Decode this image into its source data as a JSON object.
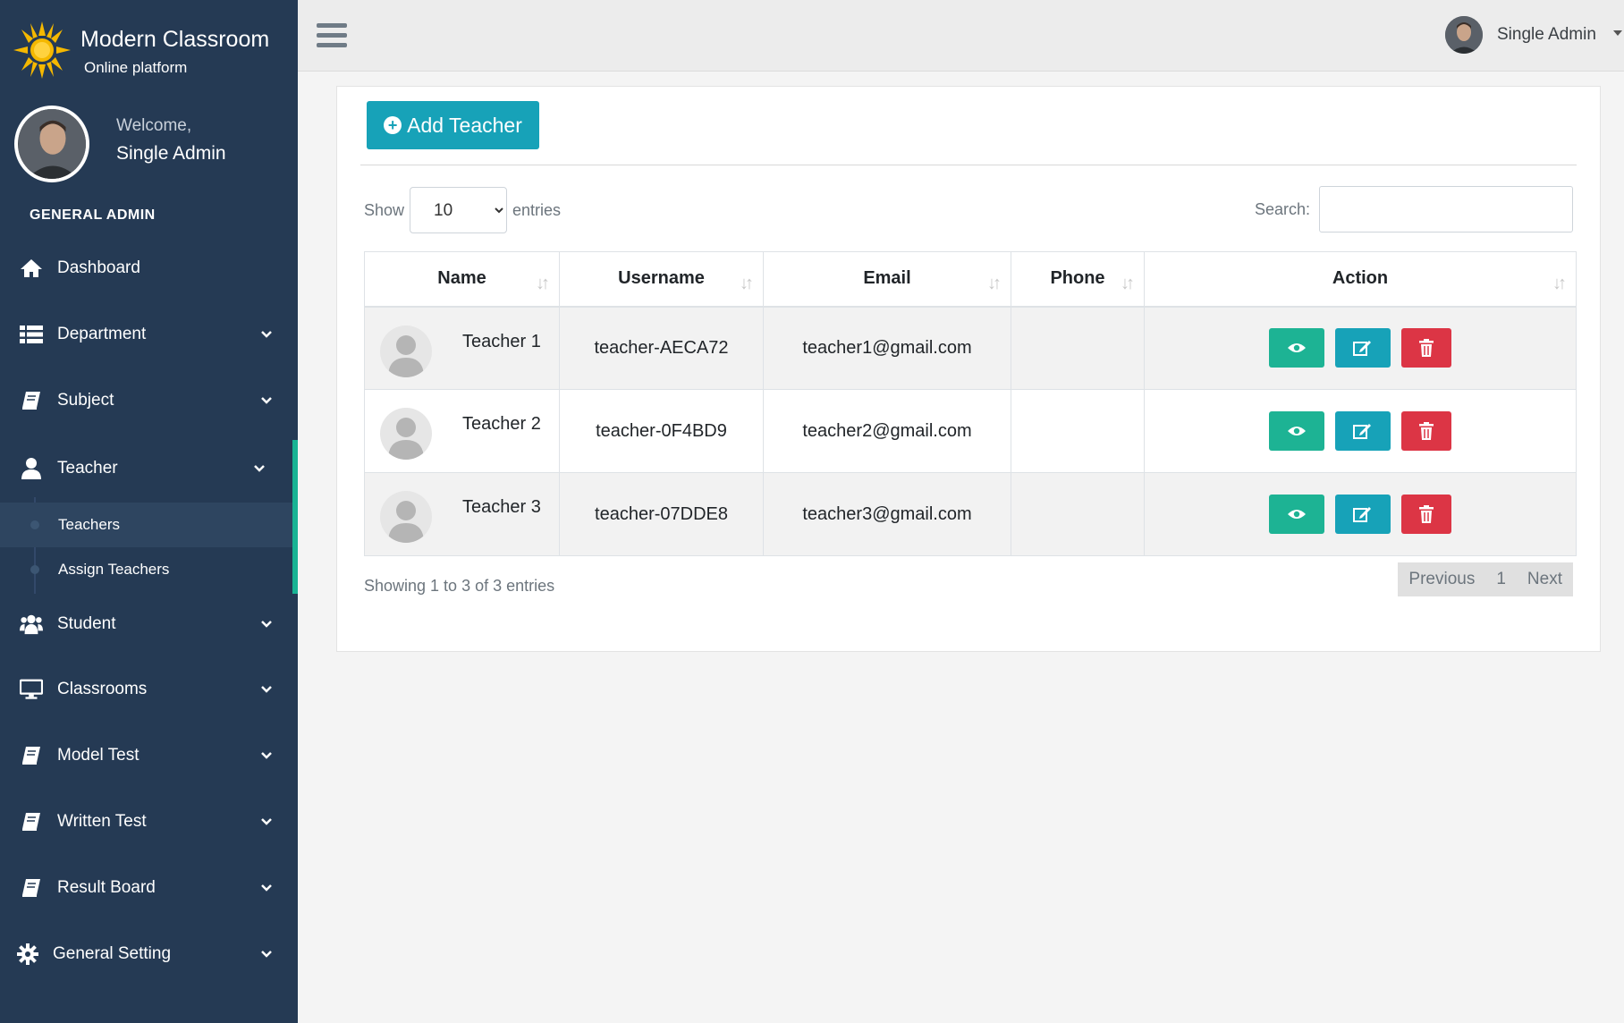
{
  "brand": {
    "name": "Modern Classroom",
    "tagline": "Online platform",
    "logo_icon": "sun-logo-icon"
  },
  "profile": {
    "welcome": "Welcome,",
    "name": "Single Admin"
  },
  "sidebar": {
    "section_title": "GENERAL ADMIN",
    "items": [
      {
        "label": "Dashboard",
        "icon": "home-icon"
      },
      {
        "label": "Department",
        "icon": "list-icon"
      },
      {
        "label": "Subject",
        "icon": "book-icon"
      },
      {
        "label": "Teacher",
        "icon": "user-icon"
      },
      {
        "label": "Student",
        "icon": "users-icon"
      },
      {
        "label": "Classrooms",
        "icon": "monitor-icon"
      },
      {
        "label": "Model Test",
        "icon": "book-icon"
      },
      {
        "label": "Written Test",
        "icon": "book-icon"
      },
      {
        "label": "Result Board",
        "icon": "book-icon"
      },
      {
        "label": "General Setting",
        "icon": "gear-icon"
      }
    ],
    "teacher_submenu": [
      {
        "label": "Teachers",
        "active": true
      },
      {
        "label": "Assign Teachers",
        "active": false
      }
    ],
    "accent_color": "#19b394",
    "background_color": "#253a54"
  },
  "topbar": {
    "user_name": "Single Admin"
  },
  "main": {
    "add_button": "Add Teacher",
    "show_label": "Show",
    "entries_label": "entries",
    "page_length": "10",
    "search_label": "Search:",
    "search_value": "",
    "columns": [
      "Name",
      "Username",
      "Email",
      "Phone",
      "Action"
    ],
    "rows": [
      {
        "name": "Teacher 1",
        "username": "teacher-AECA72",
        "email": "teacher1@gmail.com",
        "phone": ""
      },
      {
        "name": "Teacher 2",
        "username": "teacher-0F4BD9",
        "email": "teacher2@gmail.com",
        "phone": ""
      },
      {
        "name": "Teacher 3",
        "username": "teacher-07DDE8",
        "email": "teacher3@gmail.com",
        "phone": ""
      }
    ],
    "info": "Showing 1 to 3 of 3 entries",
    "pagination": {
      "previous": "Previous",
      "page": "1",
      "next": "Next"
    }
  }
}
